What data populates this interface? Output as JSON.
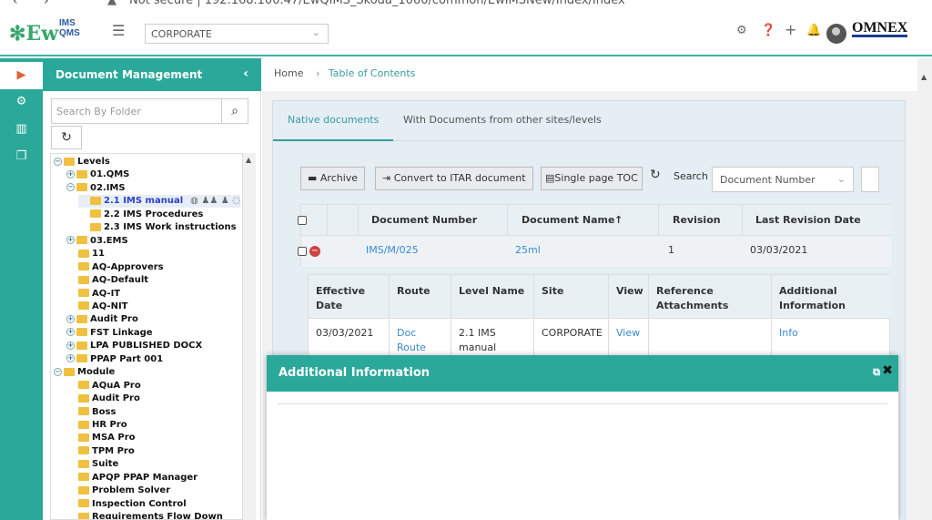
{
  "browser": {
    "nav_back": "‹",
    "nav_fwd": "›",
    "lock": "▲",
    "url": "Not secure  |  192.168.100.47/EwQIMS_Skoda_1060/common/EwIMSNew/Index/Index"
  },
  "logo": {
    "main": "Ew",
    "sup": "IMS",
    "sub": "QMS"
  },
  "header": {
    "site_select": "CORPORATE",
    "brand": "OMNEX"
  },
  "left_panel": {
    "title": "Document Management",
    "search_placeholder": "Search By Folder",
    "tree": [
      {
        "label": "Levels",
        "level": 0,
        "toggle": "−"
      },
      {
        "label": "01.QMS",
        "level": 1,
        "toggle": "+"
      },
      {
        "label": "02.IMS",
        "level": 1,
        "toggle": "−"
      },
      {
        "label": "2.1 IMS manual",
        "level": 2,
        "toggle": "",
        "selected": true
      },
      {
        "label": "2.2 IMS Procedures",
        "level": 2,
        "toggle": ""
      },
      {
        "label": "2.3 IMS Work instructions",
        "level": 2,
        "toggle": ""
      },
      {
        "label": "03.EMS",
        "level": 1,
        "toggle": "+"
      },
      {
        "label": "11",
        "level": 1,
        "toggle": ""
      },
      {
        "label": "AQ-Approvers",
        "level": 1,
        "toggle": ""
      },
      {
        "label": "AQ-Default",
        "level": 1,
        "toggle": ""
      },
      {
        "label": "AQ-IT",
        "level": 1,
        "toggle": ""
      },
      {
        "label": "AQ-NIT",
        "level": 1,
        "toggle": ""
      },
      {
        "label": "Audit Pro",
        "level": 1,
        "toggle": "+"
      },
      {
        "label": "FST Linkage",
        "level": 1,
        "toggle": "+"
      },
      {
        "label": "LPA PUBLISHED DOCX",
        "level": 1,
        "toggle": "+"
      },
      {
        "label": "PPAP Part 001",
        "level": 1,
        "toggle": "+"
      },
      {
        "label": "Module",
        "level": 0,
        "toggle": "−"
      },
      {
        "label": "AQuA Pro",
        "level": 1,
        "toggle": ""
      },
      {
        "label": "Audit Pro",
        "level": 1,
        "toggle": ""
      },
      {
        "label": "Boss",
        "level": 1,
        "toggle": ""
      },
      {
        "label": "HR Pro",
        "level": 1,
        "toggle": ""
      },
      {
        "label": "MSA Pro",
        "level": 1,
        "toggle": ""
      },
      {
        "label": "TPM Pro",
        "level": 1,
        "toggle": ""
      },
      {
        "label": "Suite",
        "level": 1,
        "toggle": ""
      },
      {
        "label": "APQP PPAP Manager",
        "level": 1,
        "toggle": ""
      },
      {
        "label": "Problem Solver",
        "level": 1,
        "toggle": ""
      },
      {
        "label": "Inspection Control",
        "level": 1,
        "toggle": ""
      },
      {
        "label": "Requirements Flow Down",
        "level": 1,
        "toggle": ""
      }
    ]
  },
  "breadcrumb": {
    "home": "Home",
    "sep": "›",
    "current": "Table of Contents"
  },
  "tabs": {
    "native": "Native documents",
    "other": "With Documents from other sites/levels"
  },
  "toolbar": {
    "archive": "Archive",
    "itar": "Convert to ITAR document",
    "single_toc": "Single page TOC",
    "search": "Search",
    "search_field": "Document Number"
  },
  "grid": {
    "headers": {
      "doc_number": "Document Number",
      "doc_name": "Document Name",
      "sort_icon": "↑",
      "revision": "Revision",
      "last_rev": "Last Revision Date"
    },
    "row": {
      "doc_number": "IMS/M/025",
      "doc_name": "25ml",
      "revision": "1",
      "last_rev": "03/03/2021"
    }
  },
  "detail": {
    "headers": {
      "effective1": "Effective",
      "effective2": "Date",
      "route": "Route",
      "level": "Level Name",
      "site": "Site",
      "view": "View",
      "ref1": "Reference",
      "ref2": "Attachments",
      "add1": "Additional",
      "add2": "Information"
    },
    "row": {
      "effective": "03/03/2021",
      "route1": "Doc",
      "route2": "Route",
      "level1": "2.1 IMS",
      "level2": "manual",
      "site": "CORPORATE",
      "view": "View",
      "info": "Info"
    }
  },
  "modal": {
    "title": "Additional Information"
  },
  "colors": {
    "teal": "#2aa89a",
    "link": "#3a8ad0",
    "accent": "#3a9aa0"
  }
}
